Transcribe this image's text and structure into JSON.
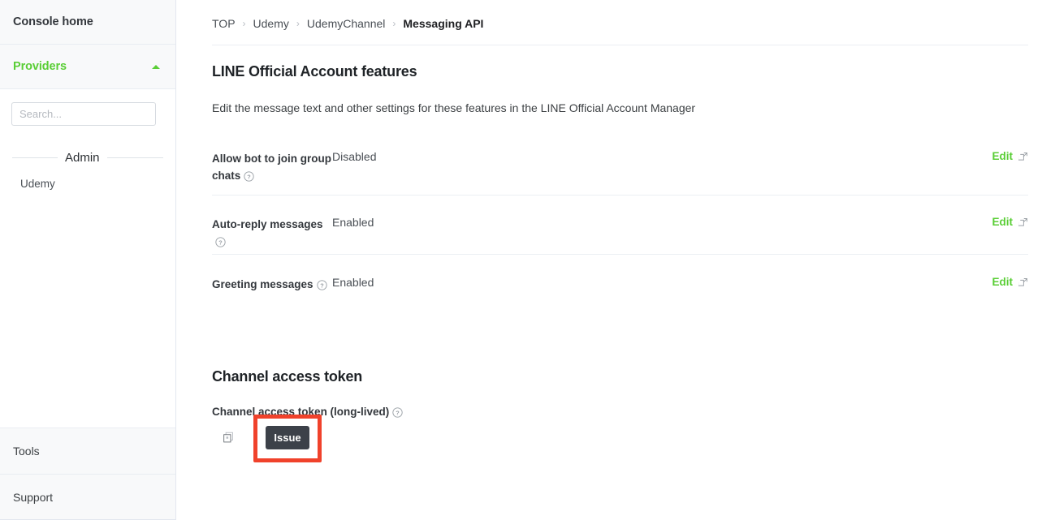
{
  "sidebar": {
    "console_home": "Console home",
    "providers": "Providers",
    "providers_caret_icon": "caret-up-icon",
    "search": {
      "placeholder": "Search...",
      "value": ""
    },
    "group_label": "Admin",
    "items": [
      {
        "label": "Udemy"
      }
    ],
    "bottom_items": [
      {
        "label": "Tools"
      },
      {
        "label": "Support"
      }
    ]
  },
  "breadcrumb": {
    "items": [
      {
        "label": "TOP",
        "current": false
      },
      {
        "label": "Udemy",
        "current": false
      },
      {
        "label": "UdemyChannel",
        "current": false
      },
      {
        "label": "Messaging API",
        "current": true
      }
    ],
    "separator": "›"
  },
  "features_section": {
    "title": "LINE Official Account features",
    "description": "Edit the message text and other settings for these features in the LINE Official Account Manager",
    "edit_label": "Edit",
    "help_icon": "help-circle-icon",
    "external_link_icon": "external-link-icon",
    "rows": [
      {
        "label": "Allow bot to join group chats",
        "value": "Disabled"
      },
      {
        "label": "Auto-reply messages",
        "value": "Enabled"
      },
      {
        "label": "Greeting messages",
        "value": "Enabled"
      }
    ]
  },
  "token_section": {
    "title": "Channel access token",
    "field_label": "Channel access token (long-lived)",
    "help_icon": "help-circle-icon",
    "copy_icon": "copy-icon",
    "issue_button": "Issue"
  },
  "colors": {
    "accent_green": "#5ace36",
    "highlight_red": "#f0422b",
    "button_dark": "#3c4149",
    "sidebar_bg": "#f8f9fa"
  }
}
